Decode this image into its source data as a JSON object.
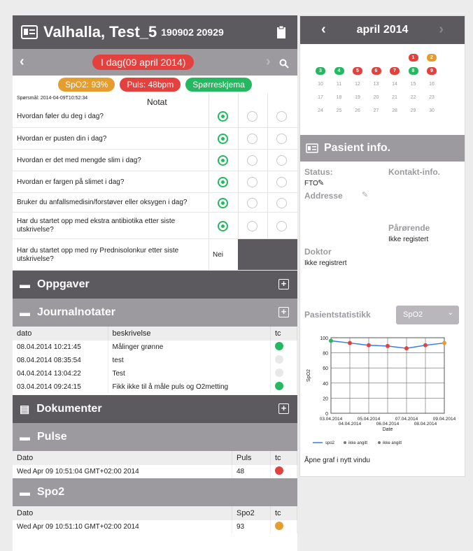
{
  "patient": {
    "name": "Valhalla, Test_5",
    "id": "190902 20929"
  },
  "date_nav": {
    "label": "I dag(09 april 2014)"
  },
  "vitals": {
    "spo2": "SpO2: 93%",
    "puls": "Puls: 48bpm",
    "skjema": "Spørreskjema"
  },
  "questionnaire": {
    "question_ts": "Spørsmål: 2014-04-09T10:52:34",
    "notat": "Notat",
    "rows": [
      {
        "q": "Hvordan føler du deg i dag?",
        "sel": 0
      },
      {
        "q": "Hvordan er pusten din i dag?",
        "sel": 0
      },
      {
        "q": "Hvordan er det med mengde slim i dag?",
        "sel": 0
      },
      {
        "q": "Hvordan er fargen på slimet i dag?",
        "sel": 0
      },
      {
        "q": "Bruker du anfallsmedisin/forstøver eller oksygen i dag?",
        "sel": 0
      },
      {
        "q": "Har du startet opp med ekstra antibiotika etter siste utskrivelse?",
        "sel": 0
      },
      {
        "q": "Har du startet opp med ny Prednisolonkur etter siste utskrivelse?",
        "text": "Nei"
      }
    ]
  },
  "sections": {
    "oppgaver": "Oppgaver",
    "journalnotater": "Journalnotater",
    "dokumenter": "Dokumenter",
    "pulse": "Pulse",
    "spo2": "Spo2"
  },
  "journal": {
    "headers": [
      "dato",
      "beskrivelse",
      "tc"
    ],
    "rows": [
      {
        "dato": "08.04.2014 10:21:45",
        "beskr": "Målinger grønne",
        "c": "#26b860"
      },
      {
        "dato": "08.04.2014 08:35:54",
        "beskr": "test",
        "c": "#e8e8e8"
      },
      {
        "dato": "04.04.2014 13:04:22",
        "beskr": "Test",
        "c": "#e8e8e8"
      },
      {
        "dato": "03.04.2014 09:24:15",
        "beskr": "Fikk ikke til å måle puls og O2metting",
        "c": "#26b860"
      }
    ]
  },
  "pulse": {
    "headers": [
      "Dato",
      "Puls",
      "tc"
    ],
    "row": {
      "dato": "Wed Apr 09 10:51:04 GMT+02:00 2014",
      "val": "48",
      "c": "#e3413e"
    }
  },
  "spo2": {
    "headers": [
      "Dato",
      "Spo2",
      "tc"
    ],
    "row": {
      "dato": "Wed Apr 09 10:51:10 GMT+02:00 2014",
      "val": "93",
      "c": "#e69d30"
    }
  },
  "calendar": {
    "month": "april 2014",
    "days": [
      {
        "d": "1",
        "c": "#e3413e"
      },
      {
        "d": "2",
        "c": "#e69d30"
      },
      {
        "d": "3",
        "c": "#26b860"
      },
      {
        "d": "4",
        "c": "#26b860"
      },
      {
        "d": "5",
        "c": "#e3413e"
      },
      {
        "d": "6",
        "c": "#e3413e"
      },
      {
        "d": "7",
        "c": "#e3413e"
      },
      {
        "d": "8",
        "c": "#26b860"
      },
      {
        "d": "9",
        "c": "#e3413e"
      },
      {
        "d": "10"
      },
      {
        "d": "11"
      },
      {
        "d": "12"
      },
      {
        "d": "13"
      },
      {
        "d": "14"
      },
      {
        "d": "15"
      },
      {
        "d": "16"
      },
      {
        "d": "17"
      },
      {
        "d": "18"
      },
      {
        "d": "19"
      },
      {
        "d": "20"
      },
      {
        "d": "21"
      },
      {
        "d": "22"
      },
      {
        "d": "23"
      },
      {
        "d": "24"
      },
      {
        "d": "25"
      },
      {
        "d": "26"
      },
      {
        "d": "27"
      },
      {
        "d": "28"
      },
      {
        "d": "29"
      },
      {
        "d": "30"
      }
    ]
  },
  "patient_info": {
    "title": "Pasient info.",
    "status_l": "Status:",
    "status_v": "FTO",
    "kontakt_l": "Kontakt-info.",
    "adresse_l": "Addresse",
    "parorende_l": "Pårørende",
    "parorende_v": "Ikke registert",
    "doktor_l": "Doktor",
    "doktor_v": "Ikke registrert",
    "stat_l": "Pasientstatistikk",
    "select": "SpO2",
    "open_link": "Åpne graf i nytt vindu"
  },
  "chart_data": {
    "type": "line",
    "x": [
      "03.04.2014",
      "04.04.2014",
      "05.04.2014",
      "06.04.2014",
      "07.04.2014",
      "08.04.2014",
      "09.04.2014"
    ],
    "x_ticks_top": [
      "03.04.2014",
      "05.04.2014",
      "07.04.2014",
      "09.04.2014"
    ],
    "x_ticks_bot": [
      "04.04.2014",
      "06.04.2014",
      "08.04.2014"
    ],
    "series": [
      {
        "name": "spo2",
        "values": [
          96,
          93,
          90,
          89,
          86,
          90,
          93
        ]
      }
    ],
    "point_colors": [
      "#26b860",
      "#e3413e",
      "#e3413e",
      "#e3413e",
      "#e3413e",
      "#e3413e",
      "#e69d30"
    ],
    "ylim": [
      0,
      100
    ],
    "yticks": [
      "0",
      "20",
      "40",
      "60",
      "80",
      "100"
    ],
    "xlabel": "Date",
    "ylabel": "SpO2",
    "legend": [
      "spo2",
      "ikke angitt",
      "ikke angitt"
    ],
    "grid": true
  }
}
